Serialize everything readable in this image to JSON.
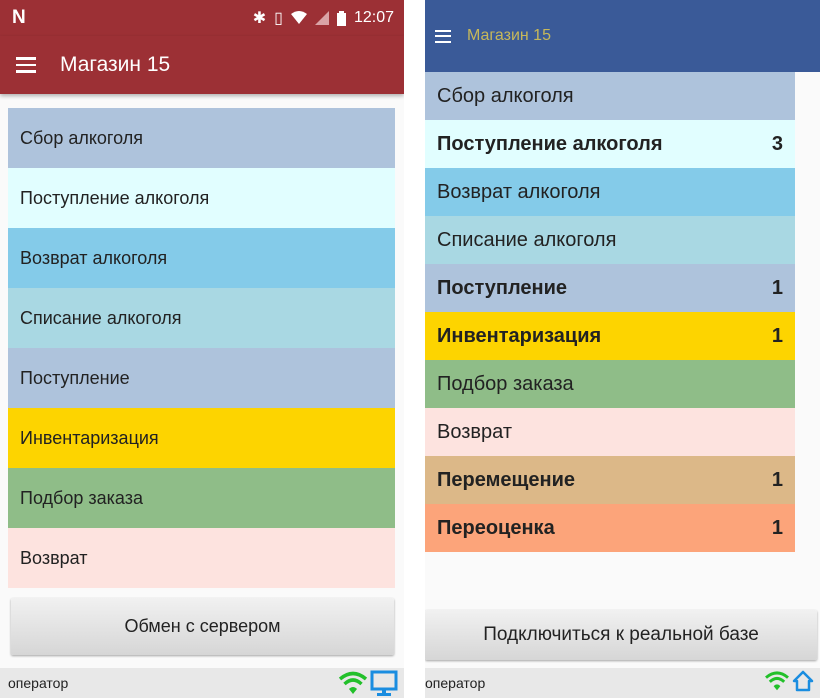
{
  "left": {
    "status_bar": {
      "time": "12:07",
      "carrier_icon": "n-logo-icon",
      "icons": [
        "bluetooth-icon",
        "vibrate-icon",
        "wifi-icon",
        "signal-icon",
        "battery-icon"
      ]
    },
    "app_bar": {
      "title": "Магазин 15",
      "color": "#9c3035"
    },
    "menu": [
      {
        "label": "Сбор алкоголя",
        "color": "#aec3dc"
      },
      {
        "label": "Поступление алкоголя",
        "color": "#e1feff"
      },
      {
        "label": "Возврат алкоголя",
        "color": "#84cbe9"
      },
      {
        "label": "Списание алкоголя",
        "color": "#a9d8e3"
      },
      {
        "label": "Поступление",
        "color": "#aec3dc"
      },
      {
        "label": "Инвентаризация",
        "color": "#fdd400"
      },
      {
        "label": "Подбор заказа",
        "color": "#8fbd88"
      },
      {
        "label": "Возврат",
        "color": "#fde3df"
      }
    ],
    "button": "Обмен с сервером",
    "footer": {
      "operator": "оператор",
      "icons": [
        "wifi-icon",
        "monitor-icon"
      ]
    }
  },
  "right": {
    "app_bar": {
      "title": "Магазин 15",
      "color": "#3a5a98"
    },
    "menu": [
      {
        "label": "Сбор алкоголя",
        "color": "#aec3dc",
        "count": ""
      },
      {
        "label": "Поступление алкоголя",
        "color": "#e1feff",
        "count": "3",
        "bold": true
      },
      {
        "label": "Возврат алкоголя",
        "color": "#84cbe9",
        "count": ""
      },
      {
        "label": "Списание алкоголя",
        "color": "#a9d8e3",
        "count": ""
      },
      {
        "label": "Поступление",
        "color": "#aec3dc",
        "count": "1",
        "bold": true
      },
      {
        "label": "Инвентаризация",
        "color": "#fdd400",
        "count": "1",
        "bold": true
      },
      {
        "label": "Подбор заказа",
        "color": "#8fbd88",
        "count": ""
      },
      {
        "label": "Возврат",
        "color": "#fde3df",
        "count": ""
      },
      {
        "label": "Перемещение",
        "color": "#dcb888",
        "count": "1",
        "bold": true
      },
      {
        "label": "Переоценка",
        "color": "#fca47a",
        "count": "1",
        "bold": true
      }
    ],
    "button": "Подключиться к реальной базе",
    "footer": {
      "operator": "оператор",
      "icons": [
        "wifi-icon",
        "home-icon"
      ]
    }
  }
}
